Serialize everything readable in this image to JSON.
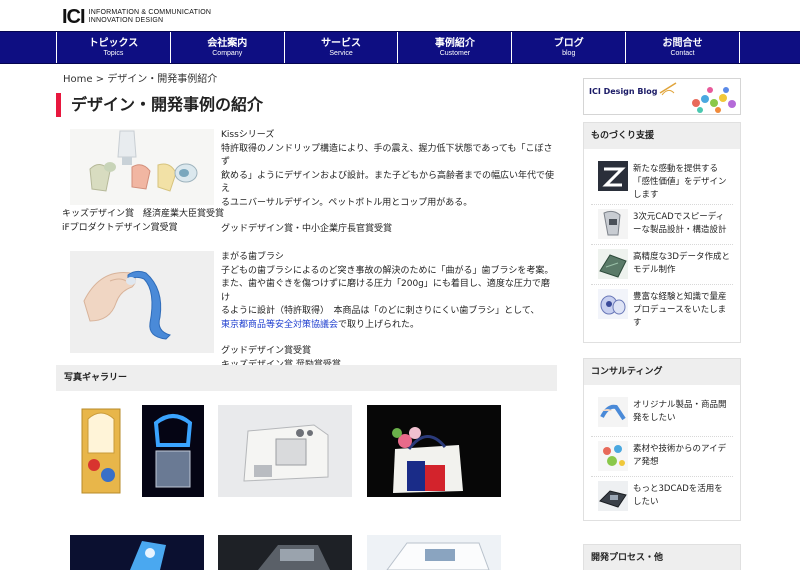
{
  "logo": {
    "mark": "ICI",
    "line1": "INFORMATION & COMMUNICATION",
    "line2": "INNOVATION DESIGN"
  },
  "nav": [
    {
      "jp": "トピックス",
      "en": "Topics"
    },
    {
      "jp": "会社案内",
      "en": "Company"
    },
    {
      "jp": "サービス",
      "en": "Service"
    },
    {
      "jp": "事例紹介",
      "en": "Customer"
    },
    {
      "jp": "ブログ",
      "en": "blog"
    },
    {
      "jp": "お問合せ",
      "en": "Contact"
    }
  ],
  "breadcrumb": {
    "home": "Home",
    "sep": ">",
    "current": "デザイン・開発事例紹介"
  },
  "page_title": "デザイン・開発事例の紹介",
  "products": [
    {
      "title": "Kissシリーズ",
      "desc": [
        "特許取得のノンドリップ構造により、手の震え、握力低下状態であっても「こぼさず",
        "飲める」ようにデザインおよび設計。また子どもから高齢者までの幅広い年代で使え",
        "るユニバーサルデザイン。ペットボトル用とコップ用がある。"
      ],
      "award_right": "グッドデザイン賞・中小企業庁長官賞受賞",
      "award_left": [
        "キッズデザイン賞　経済産業大臣賞受賞",
        "iFプロダクトデザイン賞受賞"
      ]
    },
    {
      "title": "まがる歯ブラシ",
      "desc": [
        "子どもの歯ブラシによるのど突き事故の解決のために「曲がる」歯ブラシを考案。",
        "また、歯や歯ぐきを傷つけずに磨ける圧力「200g」にも着目し、適度な圧力で磨け",
        "るように設計（特許取得）　本商品は「のどに刺さりにくい歯ブラシ」として、"
      ],
      "link": "東京都商品等安全対策協議会",
      "desc_tail": "で取り上げられた。",
      "awards": [
        "グッドデザイン賞受賞",
        "キッズデザイン賞 奨励賞受賞"
      ]
    }
  ],
  "gallery": {
    "title": "写真ギャラリー"
  },
  "sidebar": {
    "banner": "ICI Design Blog",
    "monozukuri": {
      "title": "ものづくり支援",
      "items": [
        {
          "text": "新たな感動を提供する「感性価値」をデザインします",
          "icon": "abstract-z-icon"
        },
        {
          "text": "3次元CADでスピーディーな製品設計・構造設計",
          "icon": "cad-device-icon"
        },
        {
          "text": "高精度な3Dデータ作成とモデル制作",
          "icon": "3d-model-icon"
        },
        {
          "text": "豊富な経験と知識で量産プロデュースをいたします",
          "icon": "production-icon"
        }
      ]
    },
    "consulting": {
      "title": "コンサルティング",
      "items": [
        {
          "text": "オリジナル製品・商品開発をしたい",
          "icon": "product-icon"
        },
        {
          "text": "素材や技術からのアイデア発想",
          "icon": "idea-icon"
        },
        {
          "text": "もっと3DCADを活用をしたい",
          "icon": "cad-icon"
        }
      ]
    },
    "process": {
      "title": "開発プロセス・他"
    }
  },
  "colors": {
    "nav_bg": "#0e0e82",
    "title_accent": "#e8173e",
    "link": "#1f3fcf"
  }
}
